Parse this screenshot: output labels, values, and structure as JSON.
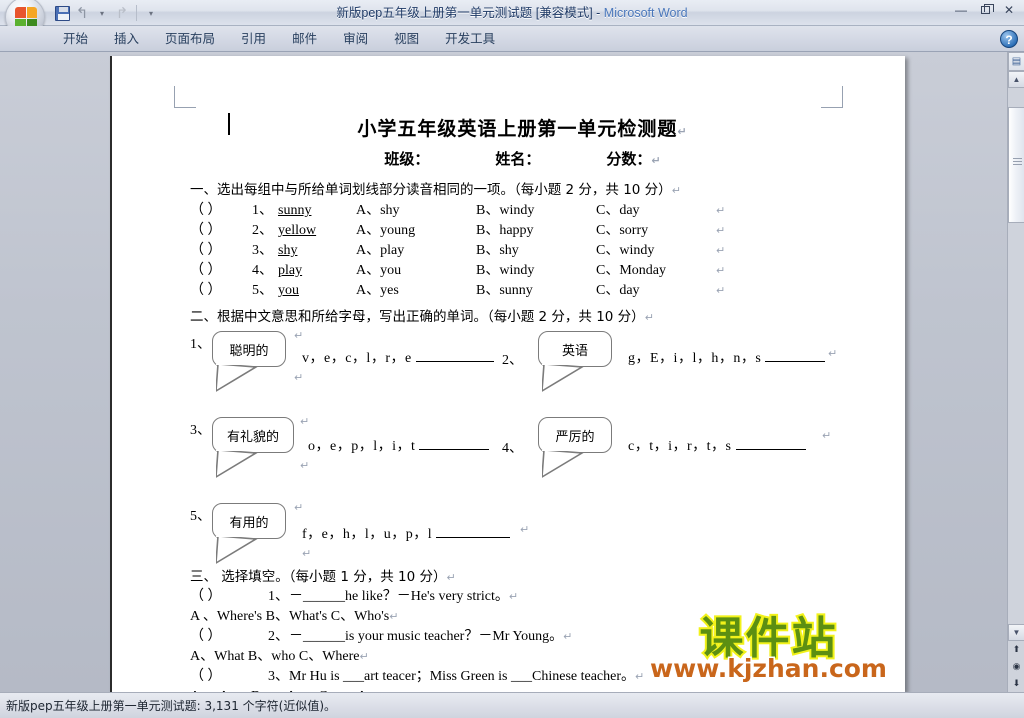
{
  "window": {
    "title": "新版pep五年级上册第一单元测试题 [兼容模式] - Microsoft Word",
    "title_main": "新版pep五年级上册第一单元测试题 [兼容模式]",
    "title_sep": " - ",
    "title_app": "Microsoft Word",
    "minimize": "—",
    "close": "✕"
  },
  "quick_access": {
    "save": "save-icon",
    "undo": "↰",
    "undo_caret": "▾",
    "redo": "↱",
    "customize": "▾"
  },
  "ribbon": {
    "tabs": [
      {
        "label": "开始"
      },
      {
        "label": "插入"
      },
      {
        "label": "页面布局"
      },
      {
        "label": "引用"
      },
      {
        "label": "邮件"
      },
      {
        "label": "审阅"
      },
      {
        "label": "视图"
      },
      {
        "label": "开发工具"
      }
    ],
    "help": "?"
  },
  "document": {
    "title": "小学五年级英语上册第一单元检测题",
    "subheads": {
      "class": "班级：",
      "name": "姓名：",
      "score": "分数："
    },
    "section1": {
      "heading": "一、选出每组中与所给单词划线部分读音相同的一项。（每小题 2 分，共 10 分）",
      "rows": [
        {
          "paren": "（        ）",
          "num": "1、",
          "stem": "sunny",
          "a": "A、shy",
          "b": "B、windy",
          "c": "C、day"
        },
        {
          "paren": "（        ）",
          "num": "2、",
          "stem": "yellow",
          "a": "A、young",
          "b": "B、happy",
          "c": "C、sorry"
        },
        {
          "paren": "（        ）",
          "num": "3、",
          "stem": "shy",
          "a": "A、play",
          "b": "B、shy",
          "c": "C、windy"
        },
        {
          "paren": "（        ）",
          "num": "4、",
          "stem": "play",
          "a": "A、you",
          "b": "B、windy",
          "c": "C、Monday"
        },
        {
          "paren": "（        ）",
          "num": "5、",
          "stem": "you",
          "a": "A、yes",
          "b": "B、sunny",
          "c": "C、day"
        }
      ]
    },
    "section2": {
      "heading": "二、根据中文意思和所给字母，写出正确的单词。（每小题 2 分，共 10 分）",
      "items": [
        {
          "index": "1、",
          "bubble": "聪明的",
          "letters": "v，e，c，l，r，e"
        },
        {
          "index": "2、",
          "bubble": "英语",
          "letters": "g，E，i，l，h，n，s"
        },
        {
          "index": "3、",
          "bubble": "有礼貌的",
          "letters": "o，e，p，l，i，t"
        },
        {
          "index": "4、",
          "bubble": "严厉的",
          "letters": "c，t，i，r，t，s"
        },
        {
          "index": "5、",
          "bubble": "有用的",
          "letters": "f，e，h，l，u，p，l"
        }
      ]
    },
    "section3": {
      "heading": "三、 选择填空。（每小题 1 分，共 10 分）",
      "items": [
        {
          "paren": "（        ）",
          "num": "1、",
          "question": "－______he like？－He's very strict。",
          "options": "A 、Where's        B、What's        C、Who's"
        },
        {
          "paren": "（        ）",
          "num": "2、",
          "question": "－______is your music teacher？－Mr Young。",
          "options": "A、What          B、who         C、Where"
        },
        {
          "paren": "（        ）",
          "num": "3、",
          "question": "Mr Hu is ___art teacer；Miss Green is ___Chinese teacher。",
          "options": "A、a；an    B、an；an     C、 an；a"
        }
      ]
    },
    "pilcrow": "↵"
  },
  "watermark": {
    "cn": "课件站",
    "url": "www.kjzhan.com"
  },
  "scrollbar": {
    "up": "▲",
    "down": "▼",
    "page_up": "⬆",
    "browse": "◉",
    "page_down": "⬇",
    "select_browse": "▤"
  },
  "statusbar": {
    "text": "新版pep五年级上册第一单元测试题: 3,131 个字符(近似值)。"
  },
  "colors": {
    "title_accent": "#4a77bb",
    "watermark_green": "#5c8f12",
    "watermark_yellow": "#f2f21b",
    "watermark_orange": "#c9661b"
  }
}
